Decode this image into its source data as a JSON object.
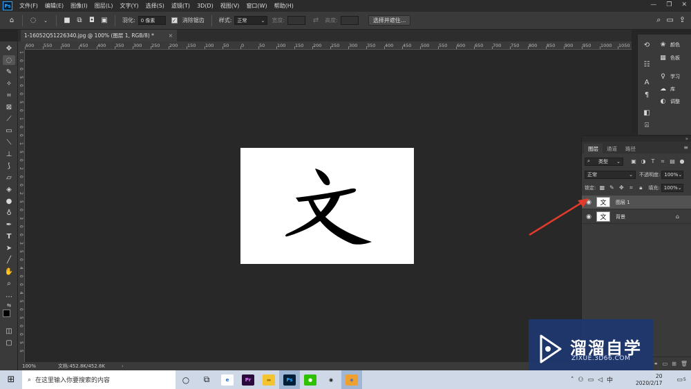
{
  "app": {
    "logo_text": "Ps",
    "menu": [
      "文件(F)",
      "编辑(E)",
      "图像(I)",
      "图层(L)",
      "文字(Y)",
      "选择(S)",
      "滤镜(T)",
      "3D(D)",
      "视图(V)",
      "窗口(W)",
      "帮助(H)"
    ],
    "window_controls": {
      "minimize": "—",
      "restore": "❐",
      "close": "✕"
    }
  },
  "options": {
    "feather_label": "羽化:",
    "feather_value": "0 像素",
    "anti_alias_label": "消除锯齿",
    "anti_alias_checked": true,
    "style_label": "样式:",
    "style_value": "正常",
    "width_label": "宽度:",
    "height_label": "高度:",
    "select_mask_button": "选择并遮住..."
  },
  "document": {
    "tab_title": "1-16052Q51226340.jpg @ 100% (图层 1, RGB/8) *",
    "tab_close": "×",
    "glyph": "文",
    "zoom": "100%",
    "doc_info": "文档:452.8K/452.8K",
    "status_arrow": "›"
  },
  "ruler": {
    "top_labels": [
      "600",
      "550",
      "500",
      "450",
      "400",
      "350",
      "300",
      "250",
      "200",
      "150",
      "100",
      "50",
      "0",
      "50",
      "100",
      "150",
      "200",
      "250",
      "300",
      "350",
      "400",
      "450",
      "500",
      "550",
      "600",
      "650",
      "700",
      "750",
      "800",
      "850",
      "900",
      "950",
      "1000",
      "1050"
    ],
    "left_labels": [
      "1",
      "0",
      "0",
      "5",
      "0",
      "0",
      "5",
      "0",
      "1",
      "0",
      "0",
      "1",
      "5",
      "0",
      "2",
      "0",
      "0",
      "2",
      "5",
      "0",
      "3",
      "0",
      "0",
      "3",
      "5",
      "0",
      "4",
      "0",
      "0",
      "4",
      "5",
      "0",
      "5",
      "0",
      "0",
      "5",
      "5"
    ]
  },
  "right_panels": {
    "items": [
      {
        "label": "颜色",
        "icon": "palette-icon"
      },
      {
        "label": "色板",
        "icon": "grid-icon"
      },
      {
        "label": "学习",
        "icon": "bulb-icon"
      },
      {
        "label": "库",
        "icon": "cloud-icon"
      },
      {
        "label": "调整",
        "icon": "half-circle-icon"
      }
    ]
  },
  "layers": {
    "tabs": [
      "图层",
      "通道",
      "路径"
    ],
    "filter_label": "类型",
    "blend_mode": "正常",
    "opacity_label": "不透明度:",
    "opacity_value": "100%",
    "lock_label": "锁定:",
    "fill_label": "填充:",
    "fill_value": "100%",
    "items": [
      {
        "name": "图层 1",
        "thumb": "文",
        "selected": true,
        "locked": false
      },
      {
        "name": "背景",
        "thumb": "文",
        "selected": false,
        "locked": true
      }
    ]
  },
  "watermark": {
    "title": "溜溜自学",
    "url": "ZIXUE.3D66.COM"
  },
  "taskbar": {
    "search_placeholder": "在这里输入你要搜索的内容",
    "time": "20",
    "date": "2020/2/17",
    "ime": "中",
    "notification_count": "5",
    "apps": [
      {
        "name": "edge",
        "text": "e",
        "bg": "#ffffff",
        "fg": "#1e6fd0"
      },
      {
        "name": "premiere",
        "text": "Pr",
        "bg": "#2a0a3a",
        "fg": "#e07bff"
      },
      {
        "name": "explorer",
        "text": "▬",
        "bg": "#f4c430",
        "fg": "#b07d00"
      },
      {
        "name": "photoshop",
        "text": "Ps",
        "bg": "#001e36",
        "fg": "#31a8ff"
      },
      {
        "name": "wechat",
        "text": "●",
        "bg": "#2dc100",
        "fg": "#ffffff"
      },
      {
        "name": "qq",
        "text": "◉",
        "bg": "#cfd8e6",
        "fg": "#111111"
      },
      {
        "name": "chrome-like",
        "text": "◈",
        "bg": "#f0a030",
        "fg": "#2a6ad0"
      }
    ]
  },
  "colors": {
    "annotation_arrow": "#e03a2a",
    "watermark_bg": "#1e376e"
  }
}
